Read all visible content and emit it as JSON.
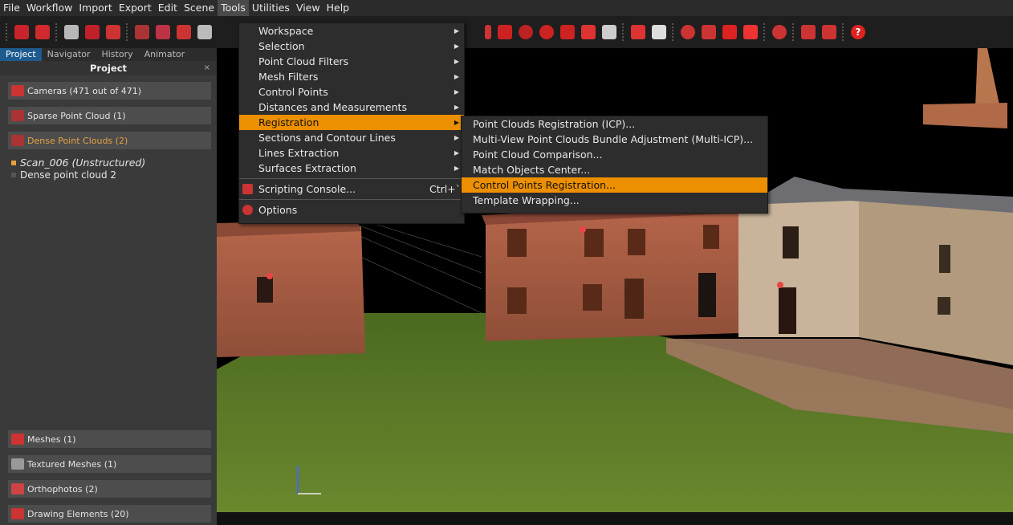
{
  "menubar": {
    "items": [
      "File",
      "Workflow",
      "Import",
      "Export",
      "Edit",
      "Scene",
      "Tools",
      "Utilities",
      "View",
      "Help"
    ],
    "active": "Tools"
  },
  "panel": {
    "tabs": [
      "Project",
      "Navigator",
      "History",
      "Animator"
    ],
    "active_tab": "Project",
    "title": "Project",
    "close": "×",
    "categories": {
      "cameras": "Cameras (471 out of 471)",
      "sparse": "Sparse Point Cloud (1)",
      "dense": "Dense Point Clouds (2)",
      "meshes": "Meshes (1)",
      "textured": "Textured Meshes (1)",
      "ortho": "Orthophotos (2)",
      "drawing": "Drawing Elements (20)"
    },
    "tree": {
      "scan": "Scan_006 (Unstructured)",
      "dense2": "Dense point cloud 2"
    }
  },
  "tools_menu": {
    "items": {
      "workspace": "Workspace",
      "selection": "Selection",
      "pc_filters": "Point Cloud Filters",
      "mesh_filters": "Mesh Filters",
      "control_points": "Control Points",
      "distances": "Distances and Measurements",
      "registration": "Registration",
      "sections": "Sections and Contour Lines",
      "lines": "Lines Extraction",
      "surfaces": "Surfaces Extraction",
      "scripting": "Scripting Console...",
      "scripting_shortcut": "Ctrl+`",
      "options": "Options"
    },
    "highlighted": "Registration"
  },
  "registration_menu": {
    "items": {
      "icp": "Point Clouds Registration (ICP)...",
      "multi_icp": "Multi-View Point Clouds Bundle Adjustment (Multi-ICP)...",
      "comparison": "Point Cloud Comparison...",
      "match": "Match Objects Center...",
      "control": "Control Points Registration...",
      "template": "Template Wrapping..."
    },
    "highlighted": "Control Points Registration..."
  },
  "colors": {
    "accent": "#ec8f00",
    "tab_active": "#1d5b8f",
    "panel_bg": "#3a3a3a",
    "menu_bg": "#2d2d2d"
  }
}
